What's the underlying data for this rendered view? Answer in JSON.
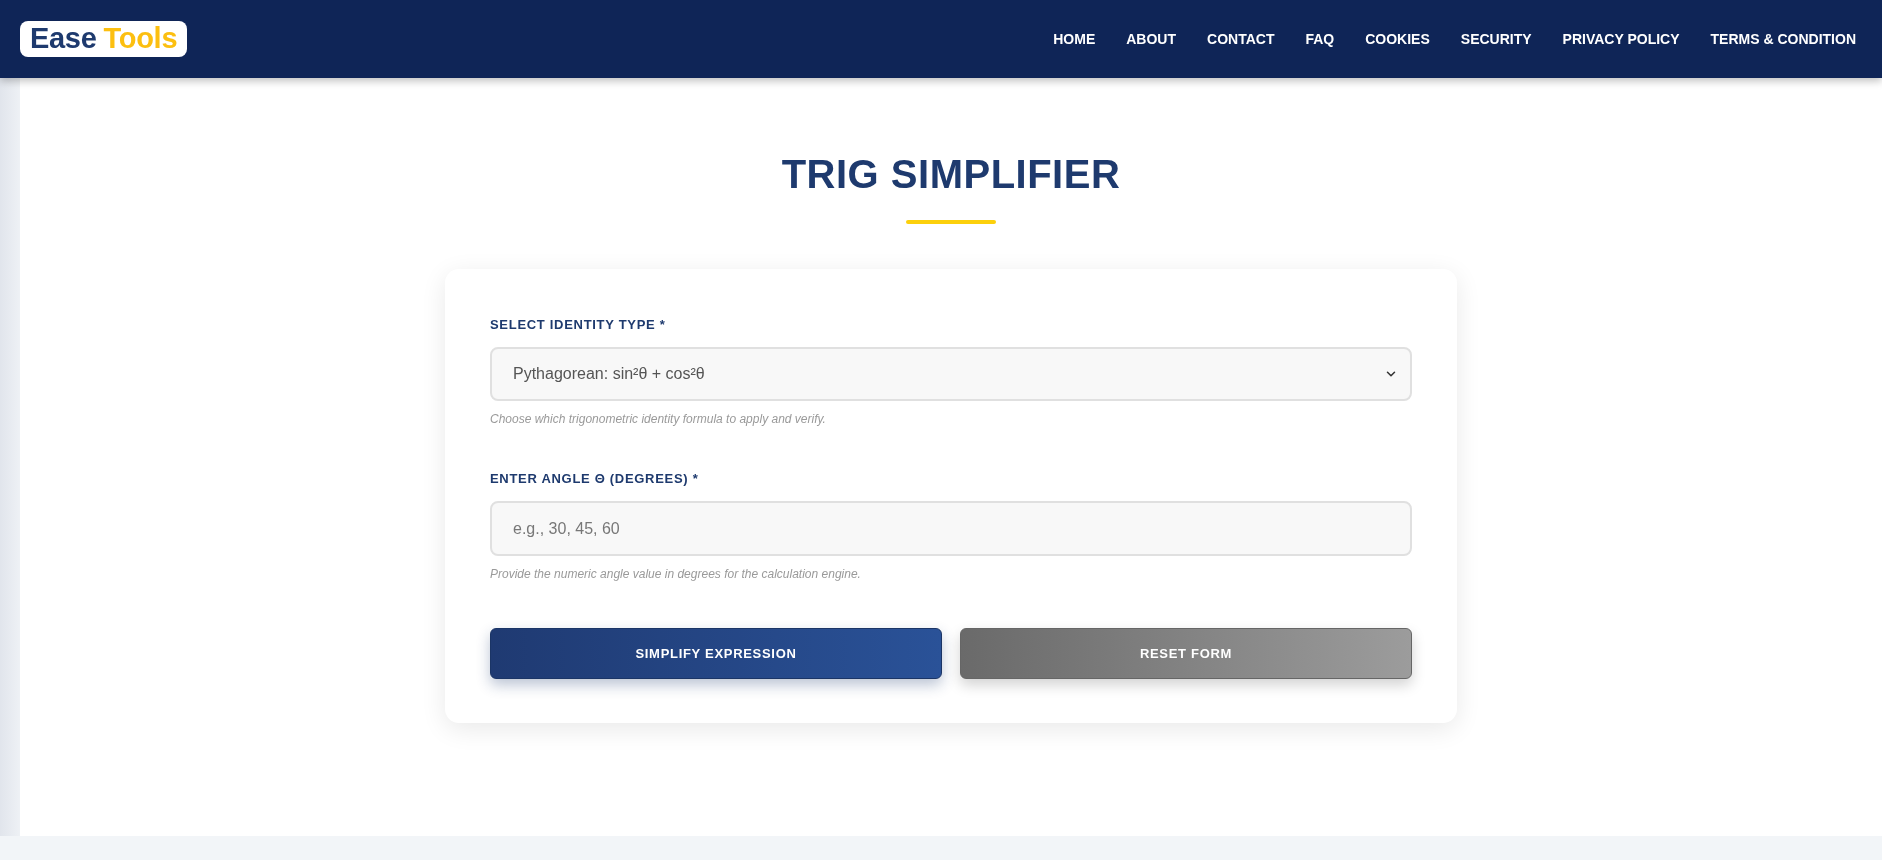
{
  "header": {
    "logo": {
      "word_1": "Ease",
      "word_2": "Tools"
    },
    "nav": [
      {
        "label": "HOME"
      },
      {
        "label": "ABOUT"
      },
      {
        "label": "CONTACT"
      },
      {
        "label": "FAQ"
      },
      {
        "label": "COOKIES"
      },
      {
        "label": "SECURITY"
      },
      {
        "label": "PRIVACY POLICY"
      },
      {
        "label": "TERMS & CONDITION"
      }
    ]
  },
  "title": "TRIG SIMPLIFIER",
  "form": {
    "fields": [
      {
        "kind": "select",
        "label": "SELECT IDENTITY TYPE *",
        "value": "Pythagorean: sin²θ + cos²θ",
        "hint": "Choose which trigonometric identity formula to apply and verify."
      },
      {
        "kind": "input",
        "label": "ENTER ANGLE Θ (DEGREES) *",
        "placeholder": "e.g., 30, 45, 60",
        "hint": "Provide the numeric angle value in degrees for the calculation engine."
      }
    ],
    "buttons": [
      {
        "kind": "primary",
        "label": "SIMPLIFY EXPRESSION"
      },
      {
        "kind": "secondary",
        "label": "RESET FORM"
      }
    ]
  }
}
